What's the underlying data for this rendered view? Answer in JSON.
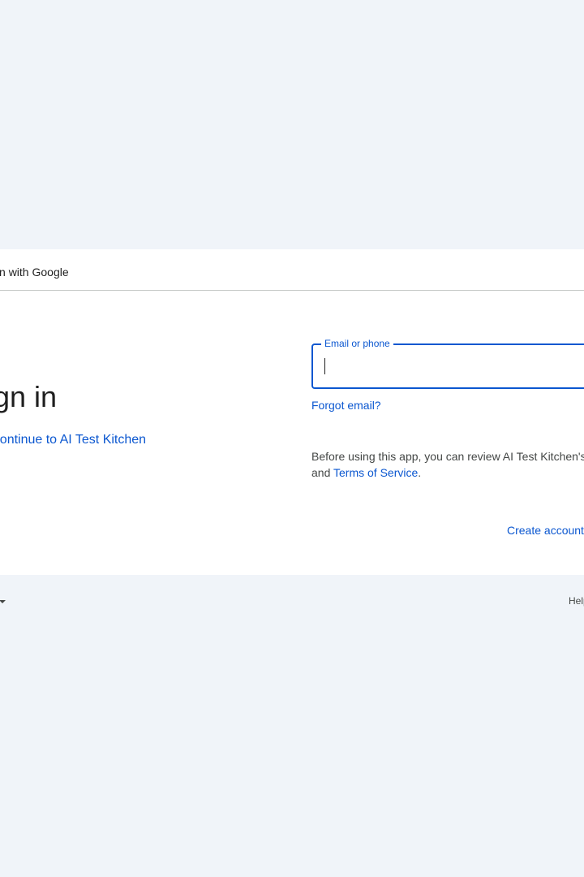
{
  "header": {
    "text": "Sign in with Google"
  },
  "left_panel": {
    "heading": "Sign in",
    "subtitle_link": "to continue to AI Test Kitchen"
  },
  "form": {
    "email_label": "Email or phone",
    "email_value": "",
    "forgot_email": "Forgot email?",
    "disclaimer_text": "Before using this app, you can review AI Test Kitchen's",
    "disclaimer_and": "and",
    "terms_link": "Terms of Service",
    "terms_period": ".",
    "create_account": "Create account"
  },
  "footer": {
    "help": "Help"
  },
  "colors": {
    "background": "#f0f4f9",
    "card": "#ffffff",
    "accent": "#0b57d0",
    "divider": "#c4c7c5"
  },
  "icons": {
    "language_dropdown": "chevron-down-icon"
  }
}
